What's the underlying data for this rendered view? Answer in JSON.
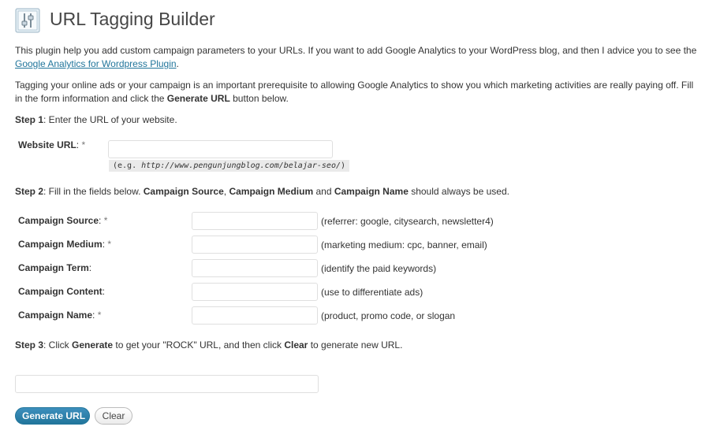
{
  "header": {
    "title": "URL Tagging Builder",
    "icon": "settings-sliders-icon"
  },
  "intro": {
    "p1_text": "This plugin help you add custom campaign parameters to your URLs. If you want to add Google Analytics to your WordPress blog, and then I advice you to see the ",
    "p1_link": "Google Analytics for Wordpress Plugin",
    "p1_end": ".",
    "p2_text": "Tagging your online ads or your campaign is an important prerequisite to allowing Google Analytics to show you which marketing activities are really paying off. Fill in the form information and click the ",
    "p2_bold": "Generate URL",
    "p2_end": " button below."
  },
  "step1": {
    "label": "Step 1",
    "text": ": Enter the URL of your website.",
    "website_label": "Website URL",
    "website_value": "",
    "example_prefix": "(e.g. ",
    "example_url": "http://www.pengunjungblog.com/belajar-seo/",
    "example_suffix": ")"
  },
  "step2": {
    "label": "Step 2",
    "text1": ": Fill in the fields below. ",
    "b1": "Campaign Source",
    "sep1": ", ",
    "b2": "Campaign Medium",
    "sep2": " and ",
    "b3": "Campaign Name",
    "text2": " should always be used.",
    "fields": [
      {
        "label": "Campaign Source",
        "required": true,
        "value": "",
        "hint": "(referrer: google, citysearch, newsletter4)"
      },
      {
        "label": "Campaign Medium",
        "required": true,
        "value": "",
        "hint": "(marketing medium: cpc, banner, email)"
      },
      {
        "label": "Campaign Term",
        "required": false,
        "value": "",
        "hint": "(identify the paid keywords)"
      },
      {
        "label": "Campaign Content",
        "required": false,
        "value": "",
        "hint": "(use to differentiate ads)"
      },
      {
        "label": "Campaign Name",
        "required": true,
        "value": "",
        "hint": "(product, promo code, or slogan"
      }
    ]
  },
  "step3": {
    "label": "Step 3",
    "text1": ": Click ",
    "b1": "Generate",
    "text2": " to get your \"ROCK\" URL, and then click ",
    "b2": "Clear",
    "text3": " to generate new URL.",
    "result_value": ""
  },
  "required_mark": "*",
  "colon": ":",
  "buttons": {
    "generate": "Generate URL",
    "clear": "Clear"
  },
  "colors": {
    "accent": "#21759b",
    "title": "#464646"
  }
}
